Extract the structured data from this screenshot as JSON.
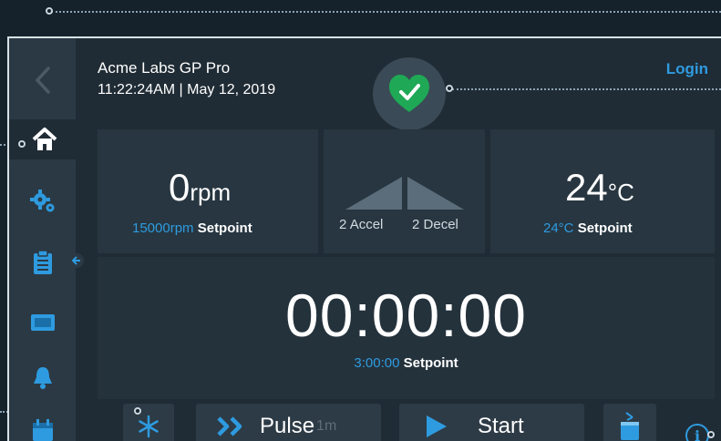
{
  "header": {
    "device_name": "Acme Labs GP Pro",
    "datetime": "11:22:24AM | May 12, 2019",
    "login_label": "Login",
    "status": "ok"
  },
  "sidebar": {
    "items": [
      {
        "icon": "back-chevron-icon"
      },
      {
        "icon": "home-icon",
        "active": true
      },
      {
        "icon": "gears-icon"
      },
      {
        "icon": "clipboard-icon"
      },
      {
        "icon": "rotor-icon"
      },
      {
        "icon": "bell-icon"
      },
      {
        "icon": "calendar-icon"
      }
    ]
  },
  "speed": {
    "value": "0",
    "unit": "rpm",
    "setpoint_value": "15000rpm",
    "setpoint_label": "Setpoint"
  },
  "accel": {
    "accel_value": "2",
    "accel_label": "Accel",
    "decel_value": "2",
    "decel_label": "Decel"
  },
  "temperature": {
    "value": "24",
    "unit": "°C",
    "setpoint_value": "24°C",
    "setpoint_label": "Setpoint"
  },
  "timer": {
    "value": "00:00:00",
    "setpoint_value": "3:00:00",
    "setpoint_label": "Setpoint"
  },
  "buttons": {
    "pulse_label": "Pulse",
    "pulse_sub": "1m",
    "start_label": "Start"
  },
  "colors": {
    "accent": "#2e9be0",
    "status_ok": "#1fa855",
    "background": "#202c35",
    "sidebar": "#2b3944"
  }
}
